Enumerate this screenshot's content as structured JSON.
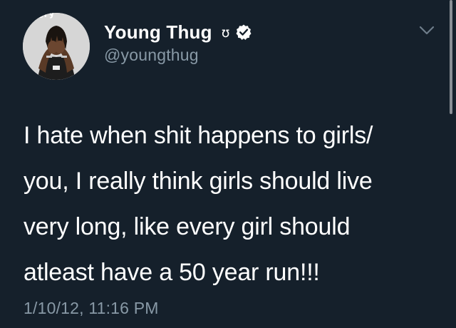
{
  "avatar": {
    "overlay_text": "ıfery",
    "description_icon": "profile-avatar"
  },
  "author": {
    "display_name": "Young Thug",
    "name_emoji": "ʊ",
    "verified_icon": "verified-badge-icon",
    "handle": "@youngthug"
  },
  "menu_icon": "chevron-down-icon",
  "tweet": {
    "lines": [
      "I hate when shit happens to girls/",
      "you, I really think girls should live",
      "very long, like every girl should",
      "atleast have a 50 year run!!!"
    ],
    "timestamp": "1/10/12, 11:16 PM"
  },
  "colors": {
    "background": "#15202b",
    "primary_text": "#ffffff",
    "secondary_text": "#8899a6"
  }
}
